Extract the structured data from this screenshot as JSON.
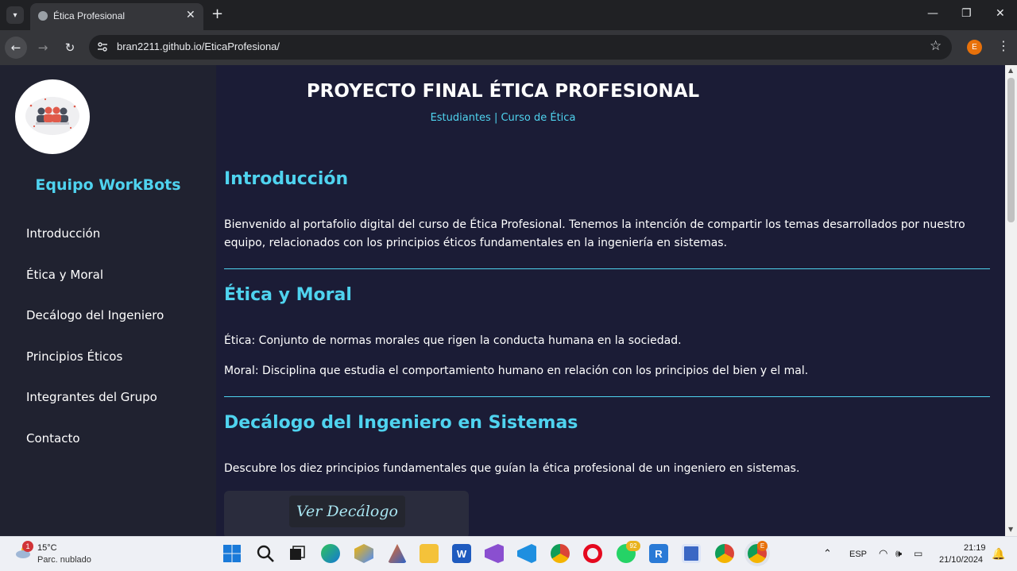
{
  "browser": {
    "tab_title": "Ética Profesional",
    "url": "bran2211.github.io/EticaProfesiona/",
    "profile_initial": "E"
  },
  "sidebar": {
    "team_name": "Equipo WorkBots",
    "items": [
      {
        "label": "Introducción"
      },
      {
        "label": "Ética y Moral"
      },
      {
        "label": "Decálogo del Ingeniero"
      },
      {
        "label": "Principios Éticos"
      },
      {
        "label": "Integrantes del Grupo"
      },
      {
        "label": "Contacto"
      }
    ]
  },
  "header": {
    "title": "PROYECTO FINAL ÉTICA PROFESIONAL",
    "subtitle": "Estudiantes | Curso de Ética"
  },
  "sections": [
    {
      "title": "Introducción",
      "paragraphs": [
        "Bienvenido al portafolio digital del curso de Ética Profesional. Tenemos la intención de compartir los temas desarrollados por nuestro equipo, relacionados con los principios éticos fundamentales en la ingeniería en sistemas."
      ]
    },
    {
      "title": "Ética y Moral",
      "paragraphs": [
        "Ética: Conjunto de normas morales que rigen la conducta humana en la sociedad.",
        "Moral: Disciplina que estudia el comportamiento humano en relación con los principios del bien y el mal."
      ]
    },
    {
      "title": "Decálogo del Ingeniero en Sistemas",
      "paragraphs": [
        "Descubre los diez principios fundamentales que guían la ética profesional de un ingeniero en sistemas."
      ],
      "button_label": "Ver Decálogo"
    }
  ],
  "taskbar": {
    "weather_temp": "15°C",
    "weather_desc": "Parc. nublado",
    "weather_badge": "1",
    "whatsapp_badge": "92",
    "chrome_profile_badge": "E",
    "language": "ESP",
    "time": "21:19",
    "date": "21/10/2024"
  },
  "colors": {
    "accent": "#4fd3ef",
    "sidebar_bg": "#202230",
    "main_bg": "#1b1c36"
  }
}
